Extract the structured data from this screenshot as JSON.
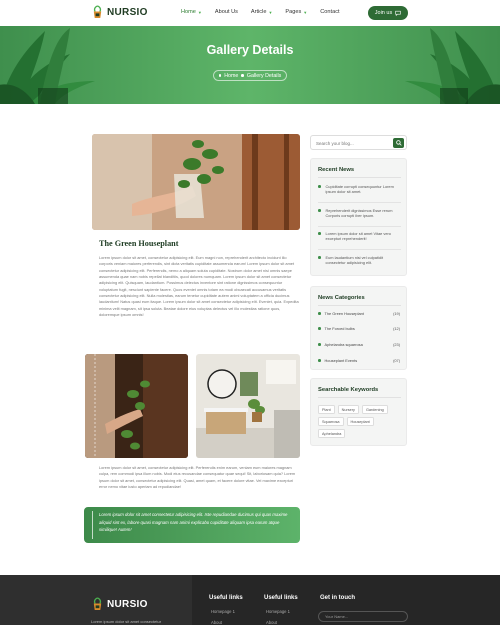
{
  "header": {
    "brand": "NURSIO",
    "nav": [
      {
        "label": "Home",
        "has_dropdown": true
      },
      {
        "label": "About Us",
        "has_dropdown": false
      },
      {
        "label": "Article",
        "has_dropdown": true
      },
      {
        "label": "Pages",
        "has_dropdown": true
      },
      {
        "label": "Contact",
        "has_dropdown": false
      }
    ],
    "join_label": "Join us"
  },
  "hero": {
    "title": "Gallery Details",
    "breadcrumb_home": "Home",
    "breadcrumb_current": "Gallery Details"
  },
  "article": {
    "title": "The Green Houseplant",
    "paragraph1": "Lorem ipsum dolor sit amet, consectetur adipisicing elit. Eum magni non, reprehenderit architecto incidunt illo corporis veniam maiores perferendis, sint dicta veritatis cupiditate assumenda earum! Lorem ipsum dolor sit amet consectetur adipisicing elit. Perferendis, nemo a aliquam soluta cupiditate. Nostrum dolor amet nisi omnis saepe assumenda quae nam nobis repellat blanditiis, quod dolores numquam. Lorem ipsum dolor sit amet consectetur adipisicing elit. Quisquam, laudantium. Possimus delectus inventore sint ratione dignissimos consequuntur voluptatum fugit, nesciunt sapiente facere. Quos eveniet omnis totam ea modi obcaecati accusamus veritatis consectetur adipisicing elit. Nulla molestias, earum tenetur cupiditate autem animi voluptatem a officia ducimus laudantium! Natus quasi eum itaque. Lorem ipsum dolor sit amet consectetur adipisicing elit. Eveniet, quia. Expedita minima velit magnam, sit ipsa soluta. Beatae dolore eius voluptas delectus vel illo molestias ratione quos, doloremque ipsum omnis!",
    "paragraph2": "Lorem ipsum dolor sit amet, consectetur adipisicing elit. Perferendis enim earum, veniam eum maiores magnam culpa, rem commodi ipsa illum nobis. Modi eius recusandae consequatur quae sequi! Sit, laboriosam quia? Lorem ipsum dolor sit amet, consectetur adipisicing elit. Quasi, amet quam, et facere dolore vitae. Vel maxime excepturi error nemo vitae iusto aperiam ad repudiandae!",
    "quote": "Lorem ipsum dolor sit amet consectetur adipisicing elit. Iste repudiandae ducimus qui quas maxime aliquid sint ex, labore quasi magnam nam animi explicabo cupiditate aliquam ipsa earum atque similique! Autem!"
  },
  "sidebar": {
    "search_placeholder": "Search your blog...",
    "recent_title": "Recent News",
    "recent": [
      "Cupiditate corrupti consequuntur Lorem ipsum dolor sit amet.",
      "Reprehenderit dignissimos Esse rerum Corporis corrupti iber ipsum.",
      "Lorem ipsum dolor sit amet Vitae vero excepturi reprehenderit!",
      "Eum laudantium nisi vel culpatidit consectetur adipisicing elit."
    ],
    "categories_title": "News Categories",
    "categories": [
      {
        "name": "The Green Houseplant",
        "count": "(19)"
      },
      {
        "name": "The Forced bulbs",
        "count": "(12)"
      },
      {
        "name": "Aphelandra squarrosa",
        "count": "(23)"
      },
      {
        "name": "Houseplant Events",
        "count": "(07)"
      }
    ],
    "keywords_title": "Searchable Keywords",
    "keywords": [
      "Plant",
      "Nursery",
      "Gardening",
      "Squarrosa",
      "Houseplant",
      "Aphelandra"
    ]
  },
  "footer": {
    "brand": "NURSIO",
    "about_text": "Lorem ipsum dolor sit amet consectetur",
    "col1_title": "Useful links",
    "col1_links": [
      "Homepage 1",
      "About"
    ],
    "col2_title": "Useful links",
    "col2_links": [
      "Homepage 1",
      "About"
    ],
    "col3_title": "Get in touch",
    "input_placeholder": "Your Name..."
  },
  "colors": {
    "brand_green": "#2e6b35",
    "hero_green": "#5eb569",
    "footer_bg": "#262626"
  }
}
